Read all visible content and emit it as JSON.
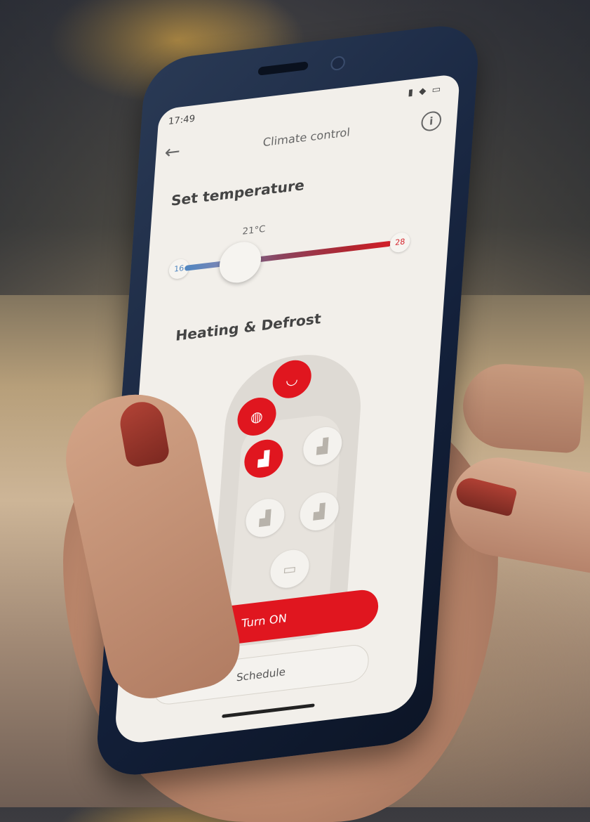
{
  "status_bar": {
    "time": "17:49",
    "icons": "▮ ◆ ▭"
  },
  "header": {
    "title": "Climate control",
    "back_icon": "←",
    "info_icon": "i"
  },
  "temperature": {
    "title": "Set temperature",
    "value": "21°C",
    "min_label": "16",
    "max_label": "28",
    "level": 0.27
  },
  "heating": {
    "title": "Heating & Defrost",
    "zones": [
      {
        "name": "front-windshield",
        "icon": "◡",
        "state": "on"
      },
      {
        "name": "steering-wheel",
        "icon": "◍",
        "state": "on"
      },
      {
        "name": "driver-seat",
        "icon": "▟",
        "state": "on"
      },
      {
        "name": "passenger-seat",
        "icon": "▟",
        "state": "off"
      },
      {
        "name": "rear-left-seat",
        "icon": "▟",
        "state": "off"
      },
      {
        "name": "rear-right-seat",
        "icon": "▟",
        "state": "off"
      },
      {
        "name": "rear-window",
        "icon": "▭",
        "state": "off"
      }
    ]
  },
  "actions": {
    "turn_on_label": "Turn ON",
    "schedule_label": "Schedule"
  },
  "colors": {
    "accent_red": "#e0161f",
    "cold_blue": "#4f86c1"
  }
}
